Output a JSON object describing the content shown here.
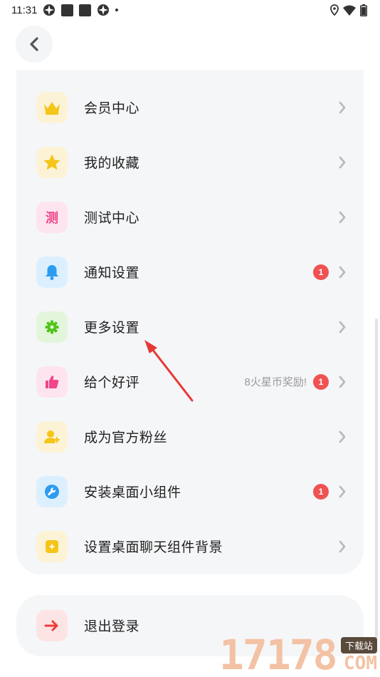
{
  "status_bar": {
    "time": "11:31"
  },
  "menu": [
    {
      "id": "vip",
      "label": "会员中心",
      "icon": "crown-icon",
      "icon_bg": "#fcf3d6",
      "badge": null,
      "note": null
    },
    {
      "id": "favorites",
      "label": "我的收藏",
      "icon": "star-icon",
      "icon_bg": "#fcf3d6",
      "badge": null,
      "note": null
    },
    {
      "id": "test",
      "label": "测试中心",
      "icon": "test-icon",
      "icon_glyph": "测",
      "icon_bg": "#fde4ef",
      "badge": null,
      "note": null
    },
    {
      "id": "notify",
      "label": "通知设置",
      "icon": "bell-icon",
      "icon_bg": "#dcefff",
      "badge": "1",
      "note": null
    },
    {
      "id": "more",
      "label": "更多设置",
      "icon": "gear-icon",
      "icon_bg": "#e3f6dc",
      "badge": null,
      "note": null
    },
    {
      "id": "rate",
      "label": "给个好评",
      "icon": "thumbs-up-icon",
      "icon_bg": "#fde4ef",
      "badge": "1",
      "note": "8火星币奖励!"
    },
    {
      "id": "fan",
      "label": "成为官方粉丝",
      "icon": "user-add-icon",
      "icon_bg": "#fcf3d6",
      "badge": null,
      "note": null
    },
    {
      "id": "widget",
      "label": "安装桌面小组件",
      "icon": "wrench-icon",
      "icon_bg": "#dcefff",
      "badge": "1",
      "note": null
    },
    {
      "id": "chat_bg",
      "label": "设置桌面聊天组件背景",
      "icon": "image-icon",
      "icon_bg": "#fcf3d6",
      "badge": null,
      "note": null
    }
  ],
  "logout": {
    "label": "退出登录",
    "icon": "logout-arrow-icon",
    "icon_bg": "#fde4e4"
  },
  "watermark": {
    "number": "17178",
    "tag": "下载站",
    "domain": "COM"
  },
  "colors": {
    "accent_red": "#e53935",
    "badge_red": "#f05252"
  }
}
